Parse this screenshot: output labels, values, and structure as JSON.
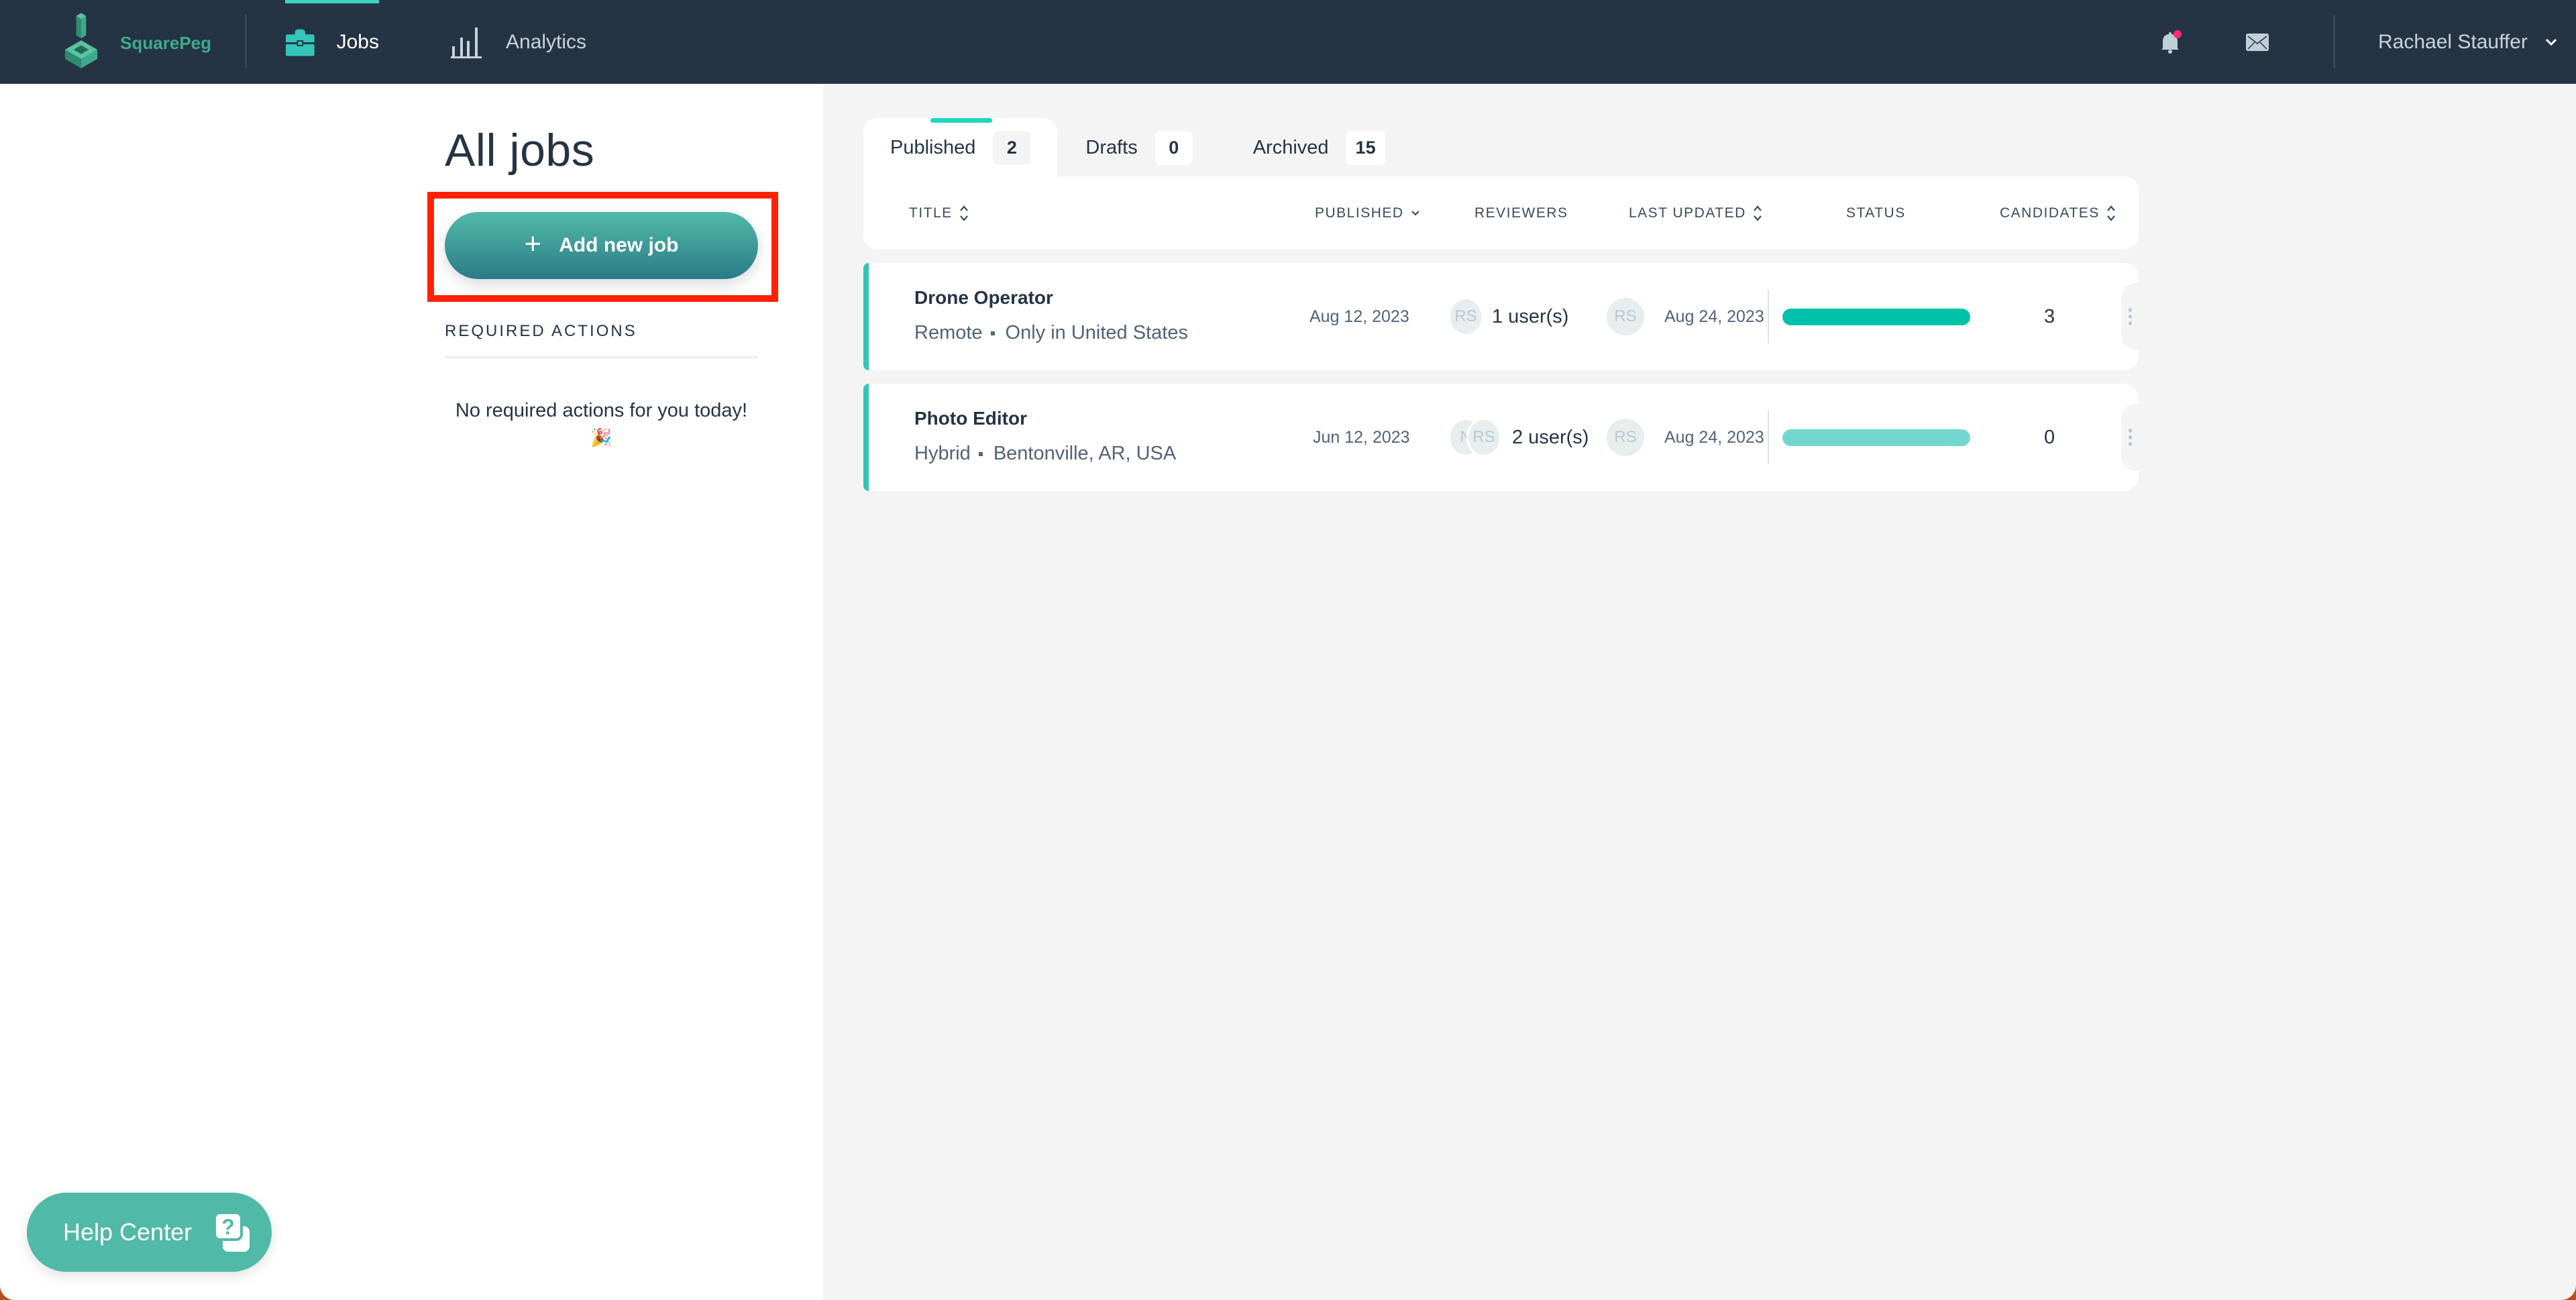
{
  "app": {
    "name": "SquarePeg",
    "brand_color": "#3dab8b",
    "accent_color": "#22d4c0"
  },
  "topnav": {
    "tabs": [
      {
        "label": "Jobs",
        "icon": "briefcase-icon",
        "active": true
      },
      {
        "label": "Analytics",
        "icon": "bar-chart-icon",
        "active": false
      }
    ],
    "notifications_icon": "bell-icon",
    "notifications_has_badge": true,
    "messages_icon": "mail-icon",
    "user_name": "Rachael Stauffer"
  },
  "sidebar": {
    "page_title": "All jobs",
    "add_button_label": "Add new job",
    "required_actions_title": "REQUIRED ACTIONS",
    "required_actions_empty": "No required actions for you today!",
    "required_actions_emoji": "🎉"
  },
  "help_center": {
    "label": "Help Center"
  },
  "tabs": [
    {
      "label": "Published",
      "count": "2",
      "active": true
    },
    {
      "label": "Drafts",
      "count": "0",
      "active": false
    },
    {
      "label": "Archived",
      "count": "15",
      "active": false
    }
  ],
  "table": {
    "columns": {
      "title": "TITLE",
      "published": "PUBLISHED",
      "reviewers": "REVIEWERS",
      "last_updated": "LAST UPDATED",
      "status": "STATUS",
      "candidates": "CANDIDATES"
    },
    "rows": [
      {
        "title": "Drone Operator",
        "work_type": "Remote",
        "location": "Only in United States",
        "published": "Aug 12, 2023",
        "reviewer_avatars": [
          "RS"
        ],
        "reviewers": "1 user(s)",
        "updated_by": "RS",
        "last_updated": "Aug 24, 2023",
        "status_color": "#00c2a8",
        "candidates": "3"
      },
      {
        "title": "Photo Editor",
        "work_type": "Hybrid",
        "location": "Bentonville, AR, USA",
        "published": "Jun 12, 2023",
        "reviewer_avatars": [
          "N",
          "RS"
        ],
        "reviewers": "2 user(s)",
        "updated_by": "RS",
        "last_updated": "Aug 24, 2023",
        "status_color": "#72d8cf",
        "candidates": "0"
      }
    ]
  }
}
